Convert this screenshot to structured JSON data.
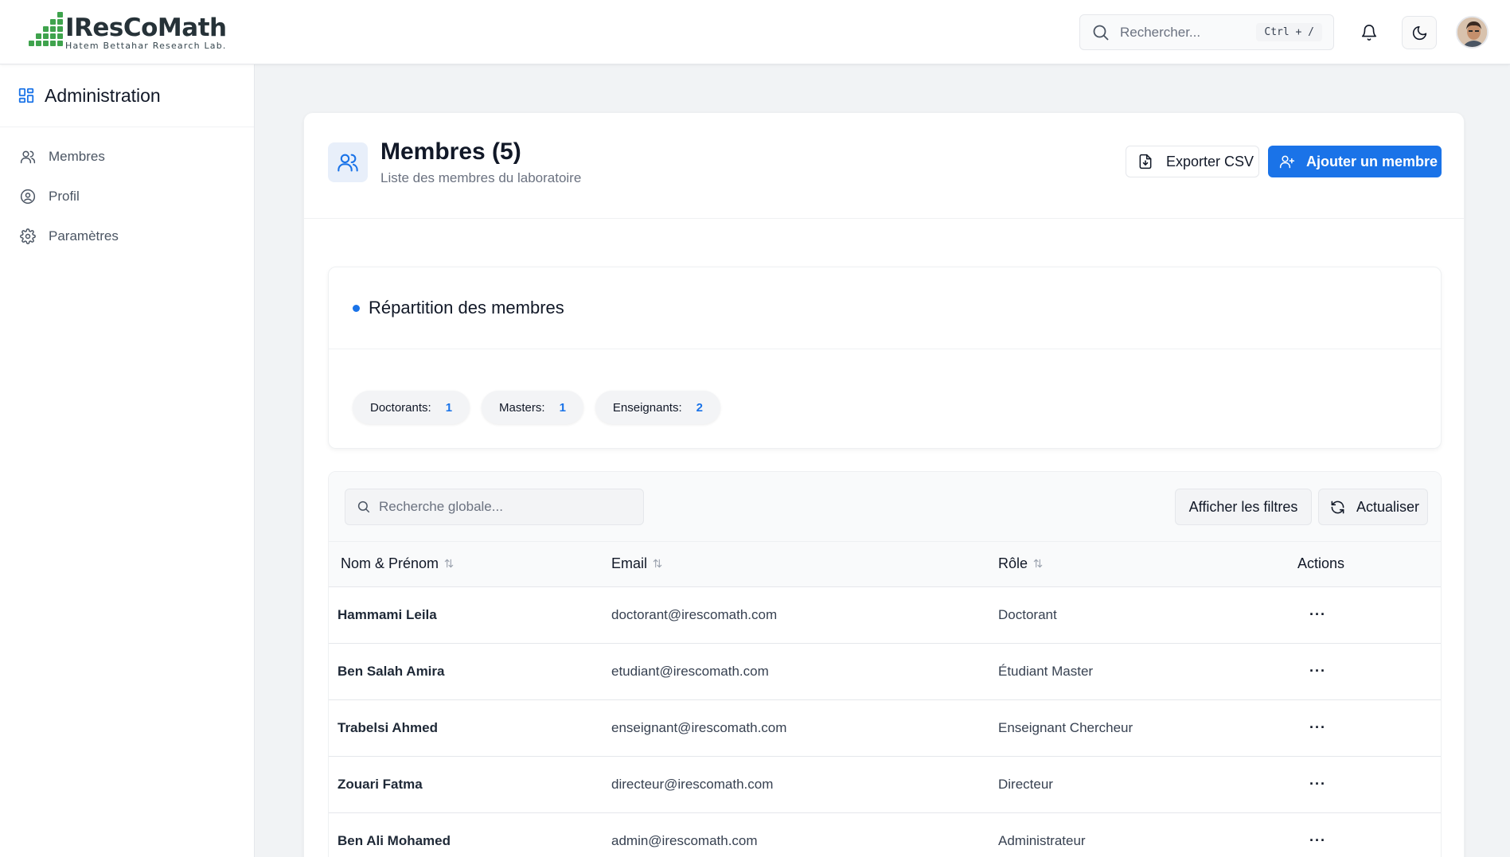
{
  "header": {
    "logo_title": "IResCoMath",
    "logo_subtitle": "Hatem Bettahar Research Lab.",
    "search_placeholder": "Rechercher...",
    "search_shortcut": "Ctrl + /"
  },
  "sidebar": {
    "title": "Administration",
    "items": [
      {
        "label": "Membres",
        "icon": "users-icon"
      },
      {
        "label": "Profil",
        "icon": "user-circle-icon"
      },
      {
        "label": "Paramètres",
        "icon": "gear-icon"
      }
    ]
  },
  "page": {
    "title": "Membres (5)",
    "subtitle": "Liste des membres du laboratoire",
    "export_label": "Exporter CSV",
    "add_label": "Ajouter un membre"
  },
  "distribution": {
    "title": "Répartition des membres",
    "chips": [
      {
        "label": "Doctorants:",
        "value": "1"
      },
      {
        "label": "Masters:",
        "value": "1"
      },
      {
        "label": "Enseignants:",
        "value": "2"
      }
    ]
  },
  "table": {
    "search_placeholder": "Recherche globale...",
    "filters_label": "Afficher les filtres",
    "refresh_label": "Actualiser",
    "columns": [
      "Nom & Prénom",
      "Email",
      "Rôle",
      "Actions"
    ],
    "rows": [
      {
        "name": "Hammami Leila",
        "email": "doctorant@irescomath.com",
        "role": "Doctorant",
        "actions": "···"
      },
      {
        "name": "Ben Salah Amira",
        "email": "etudiant@irescomath.com",
        "role": "Étudiant Master",
        "actions": "···"
      },
      {
        "name": "Trabelsi Ahmed",
        "email": "enseignant@irescomath.com",
        "role": "Enseignant Chercheur",
        "actions": "···"
      },
      {
        "name": "Zouari Fatma",
        "email": "directeur@irescomath.com",
        "role": "Directeur",
        "actions": "···"
      },
      {
        "name": "Ben Ali Mohamed",
        "email": "admin@irescomath.com",
        "role": "Administrateur",
        "actions": "···"
      }
    ]
  },
  "colors": {
    "accent": "#1a73e8",
    "logo_green": "#3fa34d"
  }
}
